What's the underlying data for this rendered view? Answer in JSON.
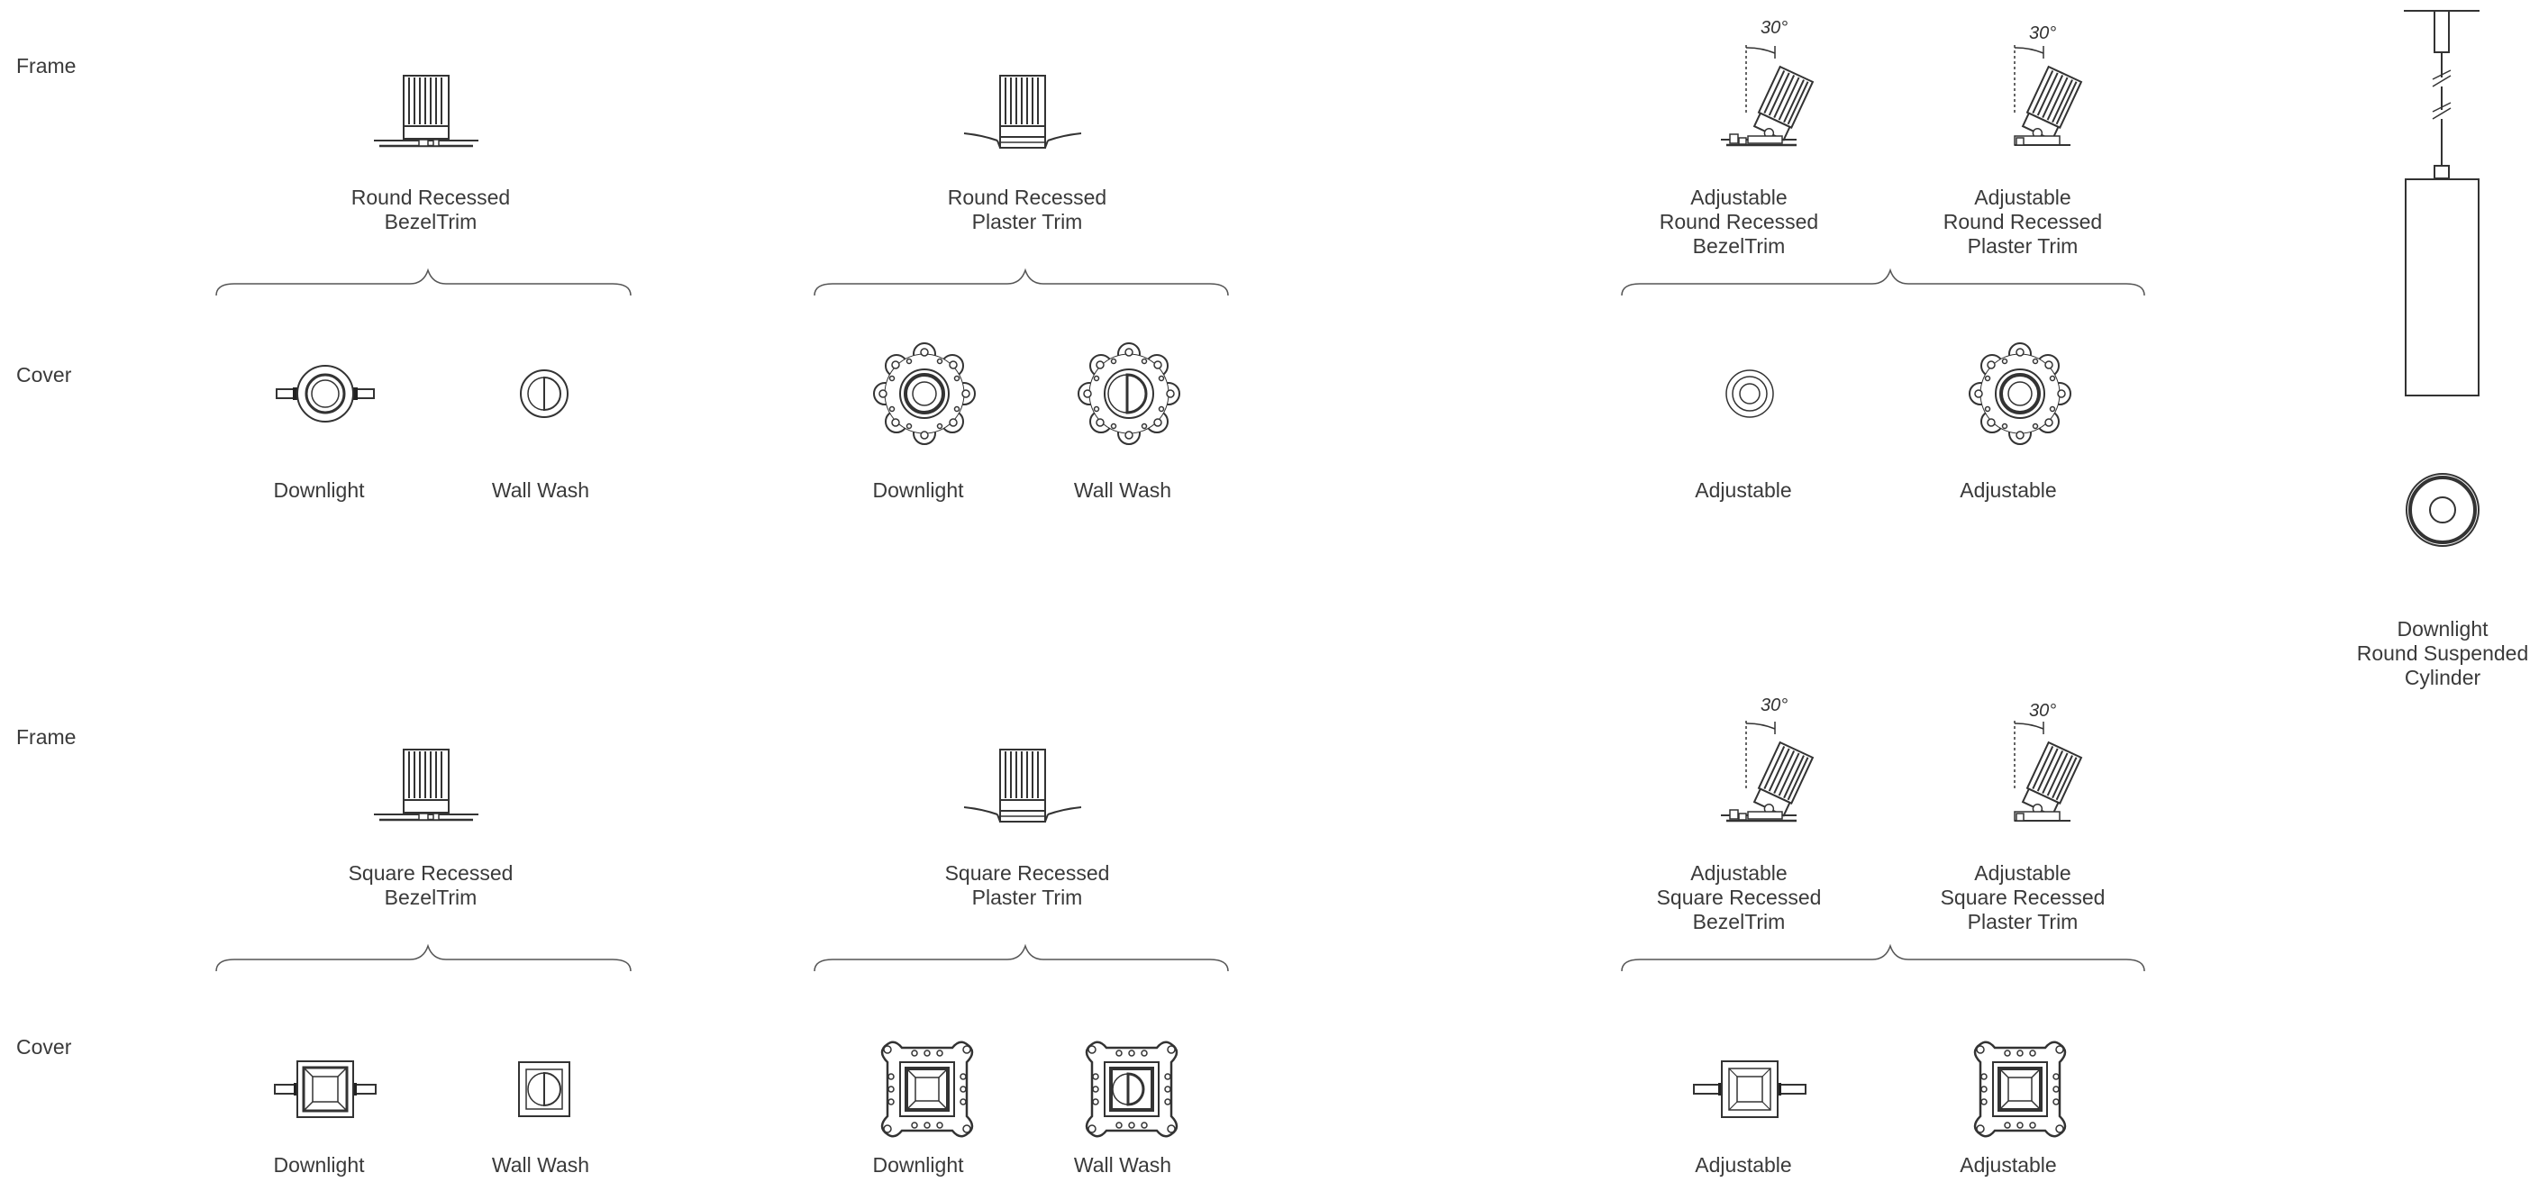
{
  "row_labels": {
    "frame": "Frame",
    "cover": "Cover"
  },
  "angle_label": "30°",
  "round": {
    "frames": [
      [
        "Round Recessed",
        "BezelTrim"
      ],
      [
        "Round Recessed",
        "Plaster Trim"
      ],
      [
        "Adjustable",
        "Round Recessed",
        "BezelTrim"
      ],
      [
        "Adjustable",
        "Round Recessed",
        "Plaster Trim"
      ]
    ],
    "covers": [
      "Downlight",
      "Wall Wash",
      "Downlight",
      "Wall Wash",
      "Adjustable",
      "Adjustable"
    ]
  },
  "square": {
    "frames": [
      [
        "Square Recessed",
        "BezelTrim"
      ],
      [
        "Square Recessed",
        "Plaster Trim"
      ],
      [
        "Adjustable",
        "Square Recessed",
        "BezelTrim"
      ],
      [
        "Adjustable",
        "Square Recessed",
        "Plaster Trim"
      ]
    ],
    "covers": [
      "Downlight",
      "Wall Wash",
      "Downlight",
      "Wall Wash",
      "Adjustable",
      "Adjustable"
    ]
  },
  "suspended": [
    "Downlight",
    "Round Suspended",
    "Cylinder"
  ]
}
